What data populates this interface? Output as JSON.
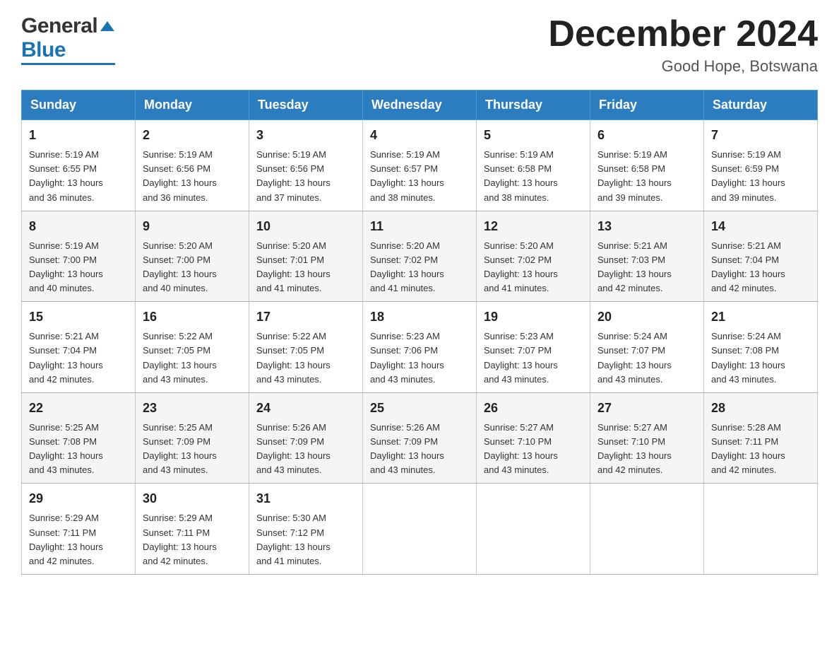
{
  "header": {
    "logo_general": "General",
    "logo_blue": "Blue",
    "title": "December 2024",
    "subtitle": "Good Hope, Botswana"
  },
  "days_of_week": [
    "Sunday",
    "Monday",
    "Tuesday",
    "Wednesday",
    "Thursday",
    "Friday",
    "Saturday"
  ],
  "weeks": [
    [
      {
        "day": "1",
        "sunrise": "5:19 AM",
        "sunset": "6:55 PM",
        "daylight": "13 hours and 36 minutes."
      },
      {
        "day": "2",
        "sunrise": "5:19 AM",
        "sunset": "6:56 PM",
        "daylight": "13 hours and 36 minutes."
      },
      {
        "day": "3",
        "sunrise": "5:19 AM",
        "sunset": "6:56 PM",
        "daylight": "13 hours and 37 minutes."
      },
      {
        "day": "4",
        "sunrise": "5:19 AM",
        "sunset": "6:57 PM",
        "daylight": "13 hours and 38 minutes."
      },
      {
        "day": "5",
        "sunrise": "5:19 AM",
        "sunset": "6:58 PM",
        "daylight": "13 hours and 38 minutes."
      },
      {
        "day": "6",
        "sunrise": "5:19 AM",
        "sunset": "6:58 PM",
        "daylight": "13 hours and 39 minutes."
      },
      {
        "day": "7",
        "sunrise": "5:19 AM",
        "sunset": "6:59 PM",
        "daylight": "13 hours and 39 minutes."
      }
    ],
    [
      {
        "day": "8",
        "sunrise": "5:19 AM",
        "sunset": "7:00 PM",
        "daylight": "13 hours and 40 minutes."
      },
      {
        "day": "9",
        "sunrise": "5:20 AM",
        "sunset": "7:00 PM",
        "daylight": "13 hours and 40 minutes."
      },
      {
        "day": "10",
        "sunrise": "5:20 AM",
        "sunset": "7:01 PM",
        "daylight": "13 hours and 41 minutes."
      },
      {
        "day": "11",
        "sunrise": "5:20 AM",
        "sunset": "7:02 PM",
        "daylight": "13 hours and 41 minutes."
      },
      {
        "day": "12",
        "sunrise": "5:20 AM",
        "sunset": "7:02 PM",
        "daylight": "13 hours and 41 minutes."
      },
      {
        "day": "13",
        "sunrise": "5:21 AM",
        "sunset": "7:03 PM",
        "daylight": "13 hours and 42 minutes."
      },
      {
        "day": "14",
        "sunrise": "5:21 AM",
        "sunset": "7:04 PM",
        "daylight": "13 hours and 42 minutes."
      }
    ],
    [
      {
        "day": "15",
        "sunrise": "5:21 AM",
        "sunset": "7:04 PM",
        "daylight": "13 hours and 42 minutes."
      },
      {
        "day": "16",
        "sunrise": "5:22 AM",
        "sunset": "7:05 PM",
        "daylight": "13 hours and 43 minutes."
      },
      {
        "day": "17",
        "sunrise": "5:22 AM",
        "sunset": "7:05 PM",
        "daylight": "13 hours and 43 minutes."
      },
      {
        "day": "18",
        "sunrise": "5:23 AM",
        "sunset": "7:06 PM",
        "daylight": "13 hours and 43 minutes."
      },
      {
        "day": "19",
        "sunrise": "5:23 AM",
        "sunset": "7:07 PM",
        "daylight": "13 hours and 43 minutes."
      },
      {
        "day": "20",
        "sunrise": "5:24 AM",
        "sunset": "7:07 PM",
        "daylight": "13 hours and 43 minutes."
      },
      {
        "day": "21",
        "sunrise": "5:24 AM",
        "sunset": "7:08 PM",
        "daylight": "13 hours and 43 minutes."
      }
    ],
    [
      {
        "day": "22",
        "sunrise": "5:25 AM",
        "sunset": "7:08 PM",
        "daylight": "13 hours and 43 minutes."
      },
      {
        "day": "23",
        "sunrise": "5:25 AM",
        "sunset": "7:09 PM",
        "daylight": "13 hours and 43 minutes."
      },
      {
        "day": "24",
        "sunrise": "5:26 AM",
        "sunset": "7:09 PM",
        "daylight": "13 hours and 43 minutes."
      },
      {
        "day": "25",
        "sunrise": "5:26 AM",
        "sunset": "7:09 PM",
        "daylight": "13 hours and 43 minutes."
      },
      {
        "day": "26",
        "sunrise": "5:27 AM",
        "sunset": "7:10 PM",
        "daylight": "13 hours and 43 minutes."
      },
      {
        "day": "27",
        "sunrise": "5:27 AM",
        "sunset": "7:10 PM",
        "daylight": "13 hours and 42 minutes."
      },
      {
        "day": "28",
        "sunrise": "5:28 AM",
        "sunset": "7:11 PM",
        "daylight": "13 hours and 42 minutes."
      }
    ],
    [
      {
        "day": "29",
        "sunrise": "5:29 AM",
        "sunset": "7:11 PM",
        "daylight": "13 hours and 42 minutes."
      },
      {
        "day": "30",
        "sunrise": "5:29 AM",
        "sunset": "7:11 PM",
        "daylight": "13 hours and 42 minutes."
      },
      {
        "day": "31",
        "sunrise": "5:30 AM",
        "sunset": "7:12 PM",
        "daylight": "13 hours and 41 minutes."
      },
      null,
      null,
      null,
      null
    ]
  ],
  "labels": {
    "sunrise": "Sunrise:",
    "sunset": "Sunset:",
    "daylight": "Daylight:"
  }
}
